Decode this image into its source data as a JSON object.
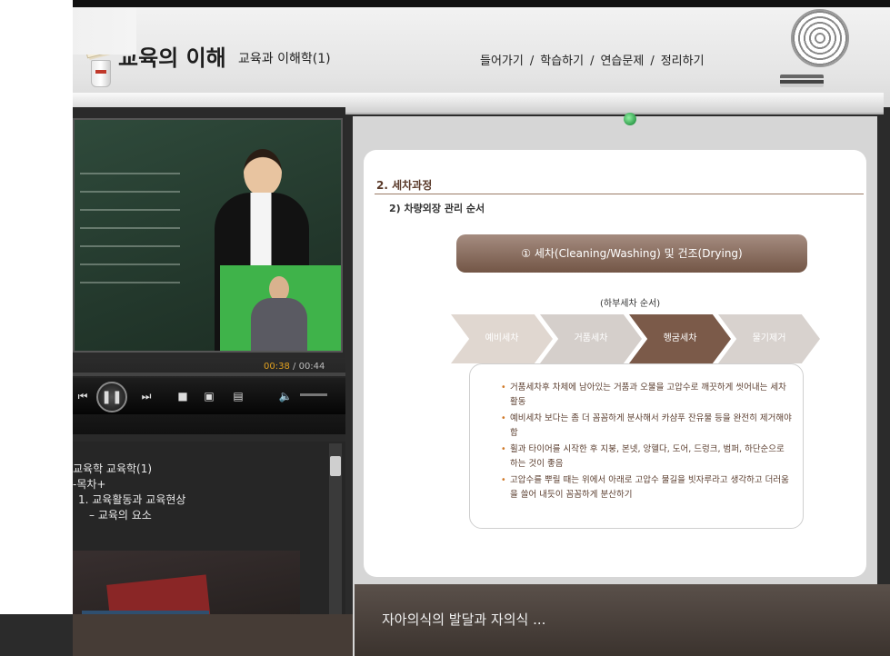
{
  "header": {
    "title": "교육의 이해",
    "subtitle": "교육과 이해학(1)",
    "nav": [
      "들어가기",
      "학습하기",
      "연습문제",
      "정리하기"
    ],
    "nav_separator": "/"
  },
  "player": {
    "time_current": "00:38",
    "time_total": "00:44",
    "time_separator": "/",
    "buttons": [
      "prev-icon",
      "pause-icon",
      "next-icon",
      "stop-icon",
      "screen-icon",
      "caption-icon",
      "volume-icon"
    ]
  },
  "toc": {
    "lines": [
      "교육학 교육학(1)",
      "-목차+",
      "1. 교육활동과 교육현상",
      "– 교육의 요소"
    ]
  },
  "slide": {
    "section_title": "2. 세차과정",
    "sub_title": "2) 차량외장 관리 순서",
    "pill": "① 세차(Cleaning/Washing) 및 건조(Drying)",
    "order_label": "(하부세차 순서)",
    "steps": [
      "예비세차",
      "거품세차",
      "헹굼세차",
      "물기제거"
    ],
    "active_step": 2,
    "bullets": [
      "거품세차후 차체에 남아있는 거품과 오물을 고압수로 깨끗하게 씻어내는 세차활동",
      "예비세차 보다는 좀 더 꼼꼼하게 분사해서 카샴푸 잔유물 등을 완전히 제거해야 함",
      "휠과 타이어를 시작한 후 지붕, 본넷, 앙헬다, 도어, 드렁크, 범퍼, 하단순으로 하는 것이 좋음",
      "고압수를 뿌릴 때는 위에서 아래로 고압수 물길을 빗자루라고 생각하고 더러움을 쓸어 내듯이 꼼꼼하게 분산하기"
    ]
  },
  "footer": {
    "caption": "자아의식의 발달과 자의식 ..."
  },
  "colors": {
    "accent_brown": "#735646",
    "active_step": "#7b5a49",
    "time_current": "#e0a020"
  }
}
